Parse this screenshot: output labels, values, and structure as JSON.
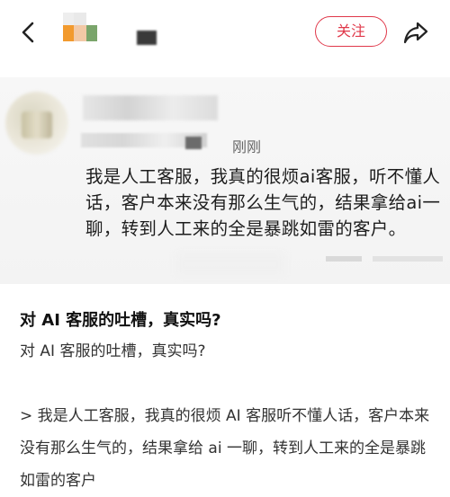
{
  "topbar": {
    "follow_label": "关注",
    "colors": {
      "accent": "#e0384a"
    },
    "icons": {
      "back": "chevron-left-icon",
      "share": "share-arrow-icon"
    }
  },
  "post_image": {
    "time_label": "刚刚",
    "comment_text": "我是人工客服，我真的很烦ai客服，听不懂人话，客户本来没有那么生气的，结果拿给ai一聊，转到人工来的全是暴跳如雷的客户。"
  },
  "post": {
    "title": "对 AI 客服的吐槽，真实吗?",
    "body": "对 AI 客服的吐槽，真实吗?",
    "quote": "> 我是人工客服，我真的很烦 AI 客服听不懂人话，客户本来没有那么生气的，结果拿给 ai 一聊，转到人工来的全是暴跳如雷的客户"
  }
}
